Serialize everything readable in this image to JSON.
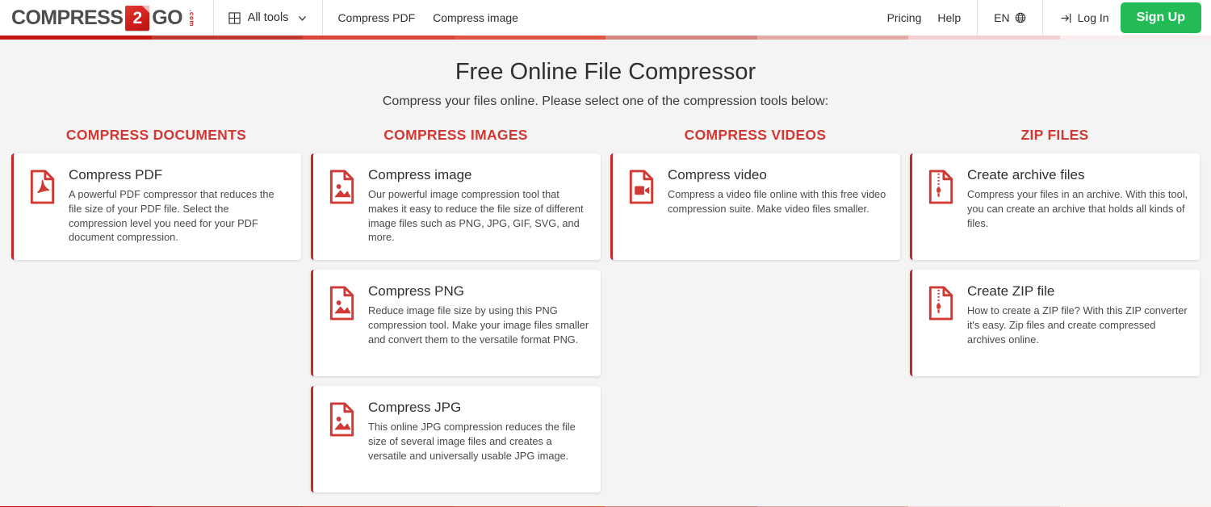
{
  "header": {
    "logo": {
      "part1": "COMPRESS",
      "badge": "2",
      "part2": "GO",
      "tld": ".com"
    },
    "all_tools_label": "All tools",
    "nav_links": [
      {
        "label": "Compress PDF"
      },
      {
        "label": "Compress image"
      }
    ],
    "right_links": [
      {
        "label": "Pricing"
      },
      {
        "label": "Help"
      }
    ],
    "language": "EN",
    "login_label": "Log In",
    "signup_label": "Sign Up",
    "signup_color": "#22bb55"
  },
  "main": {
    "title": "Free Online File Compressor",
    "subtitle": "Compress your files online. Please select one of the compression tools below:",
    "accent_color": "#d13934",
    "columns": [
      {
        "heading": "COMPRESS DOCUMENTS",
        "cards": [
          {
            "icon": "pdf-file-icon",
            "title": "Compress PDF",
            "desc": "A powerful PDF compressor that reduces the file size of your PDF file. Select the compression level you need for your PDF document compression."
          }
        ]
      },
      {
        "heading": "COMPRESS IMAGES",
        "cards": [
          {
            "icon": "image-file-icon",
            "title": "Compress image",
            "desc": "Our powerful image compression tool that makes it easy to reduce the file size of different image files such as PNG, JPG, GIF, SVG, and more."
          },
          {
            "icon": "image-file-icon",
            "title": "Compress PNG",
            "desc": "Reduce image file size by using this PNG compression tool. Make your image files smaller and convert them to the versatile format PNG."
          },
          {
            "icon": "image-file-icon",
            "title": "Compress JPG",
            "desc": "This online JPG compression reduces the file size of several image files and creates a versatile and universally usable JPG image."
          }
        ]
      },
      {
        "heading": "COMPRESS VIDEOS",
        "cards": [
          {
            "icon": "video-file-icon",
            "title": "Compress video",
            "desc": "Compress a video file online with this free video compression suite. Make video files smaller."
          }
        ]
      },
      {
        "heading": "ZIP FILES",
        "cards": [
          {
            "icon": "zip-file-icon",
            "title": "Create archive files",
            "desc": "Compress your files in an archive. With this tool, you can create an archive that holds all kinds of files."
          },
          {
            "icon": "zip-file-icon",
            "title": "Create ZIP file",
            "desc": "How to create a ZIP file? With this ZIP converter it's easy. Zip files and create compressed archives online."
          }
        ]
      }
    ]
  },
  "stripe_colors": [
    "#c51616",
    "#c0392f",
    "#d8433a",
    "#dd5441",
    "#d8857f",
    "#e2a9a5",
    "#f0cfd0",
    "#fbeced"
  ]
}
